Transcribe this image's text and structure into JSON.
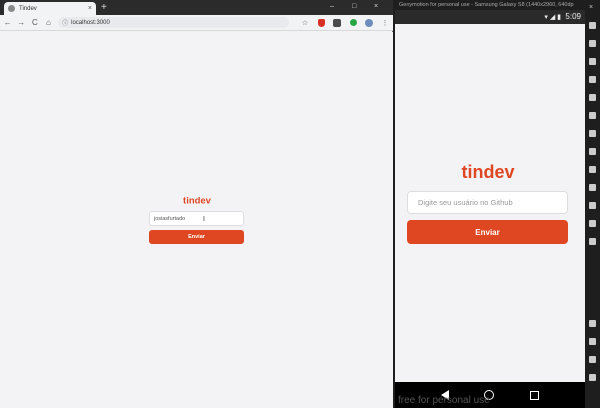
{
  "browser": {
    "tab_title": "Tindev",
    "tab_close": "×",
    "new_tab": "+",
    "url": "localhost:3000",
    "nav": {
      "back": "←",
      "forward": "→",
      "reload": "C",
      "home": "⌂"
    },
    "page": {
      "logo": "tindev",
      "input_value": "josiasfurtado",
      "button_label": "Enviar"
    }
  },
  "window_controls": {
    "min": "–",
    "max": "□",
    "close": "×"
  },
  "emulator": {
    "title": "Genymotion for personal use - Samsung Galaxy S8 (1440x2960, 640dp",
    "time": "5:09",
    "app": {
      "logo": "tindev",
      "input_placeholder": "Digite seu usuário no Github",
      "button_label": "Enviar"
    },
    "watermark": "free for personal use"
  },
  "colors": {
    "accent": "#df4723",
    "background": "#f3f3f5"
  },
  "icons": [
    "bookmark-star-icon",
    "shield-extension-icon",
    "avatar-icon",
    "menu-kebab-icon"
  ]
}
